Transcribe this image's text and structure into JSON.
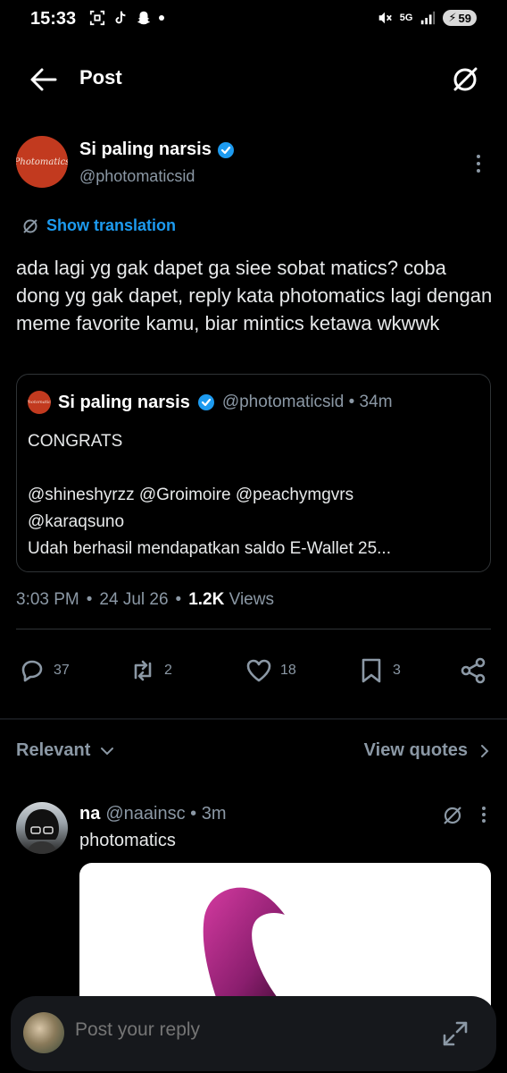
{
  "status_bar": {
    "time": "15:33",
    "network": "5G",
    "battery": "59"
  },
  "header": {
    "title": "Post"
  },
  "post": {
    "author_name": "Si paling narsis",
    "author_handle": "@photomaticsid",
    "avatar_text": "Photomatics",
    "translation_label": "Show translation",
    "text": "ada lagi yg gak dapet ga siee sobat matics? coba dong yg gak dapet, reply kata photomatics lagi dengan meme favorite kamu, biar mintics ketawa wkwwk",
    "quoted": {
      "author_name": "Si paling narsis",
      "meta": "@photomaticsid • 34m",
      "line1": "CONGRATS",
      "line2": "",
      "line3": "@shineshyrzz @Groimoire @peachymgvrs",
      "line4": "@karaqsuno",
      "line5": "Udah berhasil mendapatkan saldo E-Wallet 25..."
    },
    "time": "3:03 PM",
    "date": "24 Jul 26",
    "views_count": "1.2K",
    "views_label": "Views",
    "actions": {
      "replies": "37",
      "reposts": "2",
      "likes": "18",
      "bookmarks": "3"
    }
  },
  "sort": {
    "label": "Relevant",
    "view_quotes": "View quotes"
  },
  "reply": {
    "name": "na",
    "meta": "@naainsc • 3m",
    "text": "photomatics"
  },
  "composer": {
    "placeholder": "Post your reply"
  },
  "colors": {
    "background": "#000000",
    "accent": "#1d9bf0",
    "muted": "#8b98a5",
    "brand_avatar": "#c23a1f"
  }
}
